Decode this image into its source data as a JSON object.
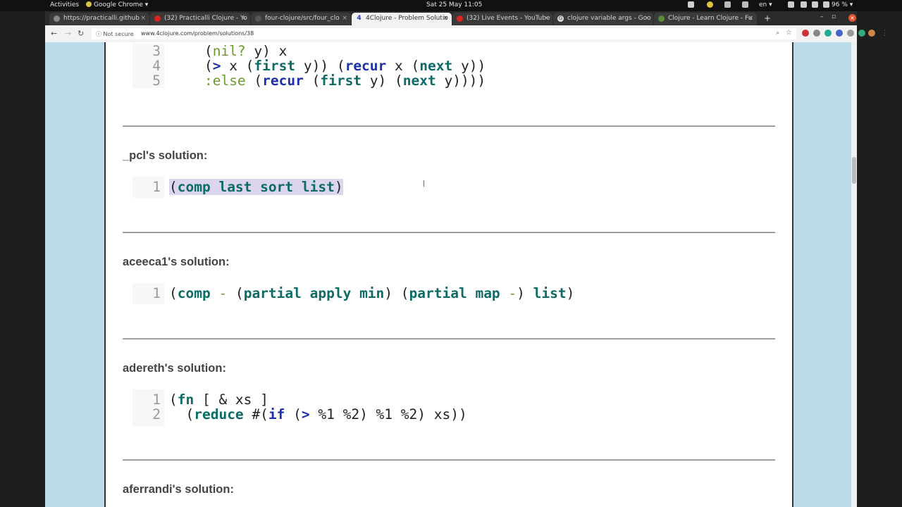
{
  "topbar": {
    "activities": "Activities",
    "app": "Google Chrome ▾",
    "clock": "Sat 25 May  11:05",
    "lang": "en ▾",
    "battery": "96 % ▾"
  },
  "tabs": [
    {
      "title": "https://practicalli.github"
    },
    {
      "title": "(32) Practicalli Clojure - Yo"
    },
    {
      "title": "four-clojure/src/four_clo"
    },
    {
      "title": "4Clojure - Problem Solutio"
    },
    {
      "title": "(32) Live Events - YouTube"
    },
    {
      "title": "clojure variable args - Goo"
    },
    {
      "title": "Clojure - Learn Clojure - Fu"
    }
  ],
  "address": {
    "security": "Not secure",
    "url": "www.4clojure.com/problem/solutions/38"
  },
  "prev_code": {
    "lines": [
      "3",
      "4",
      "5"
    ]
  },
  "solutions": [
    {
      "title": "_pcl's solution:",
      "lines": [
        "1"
      ]
    },
    {
      "title": "aceeca1's solution:",
      "lines": [
        "1"
      ]
    },
    {
      "title": "adereth's solution:",
      "lines": [
        "1",
        "2"
      ]
    },
    {
      "title": "aferrandi's solution:"
    }
  ],
  "colors": {
    "keyword": "#0b6b66",
    "builtin": "#1a2fa8",
    "keyword_literal": "#6b9b2c",
    "page_bg": "#bcdbea",
    "selection": "#dcd6ec"
  }
}
